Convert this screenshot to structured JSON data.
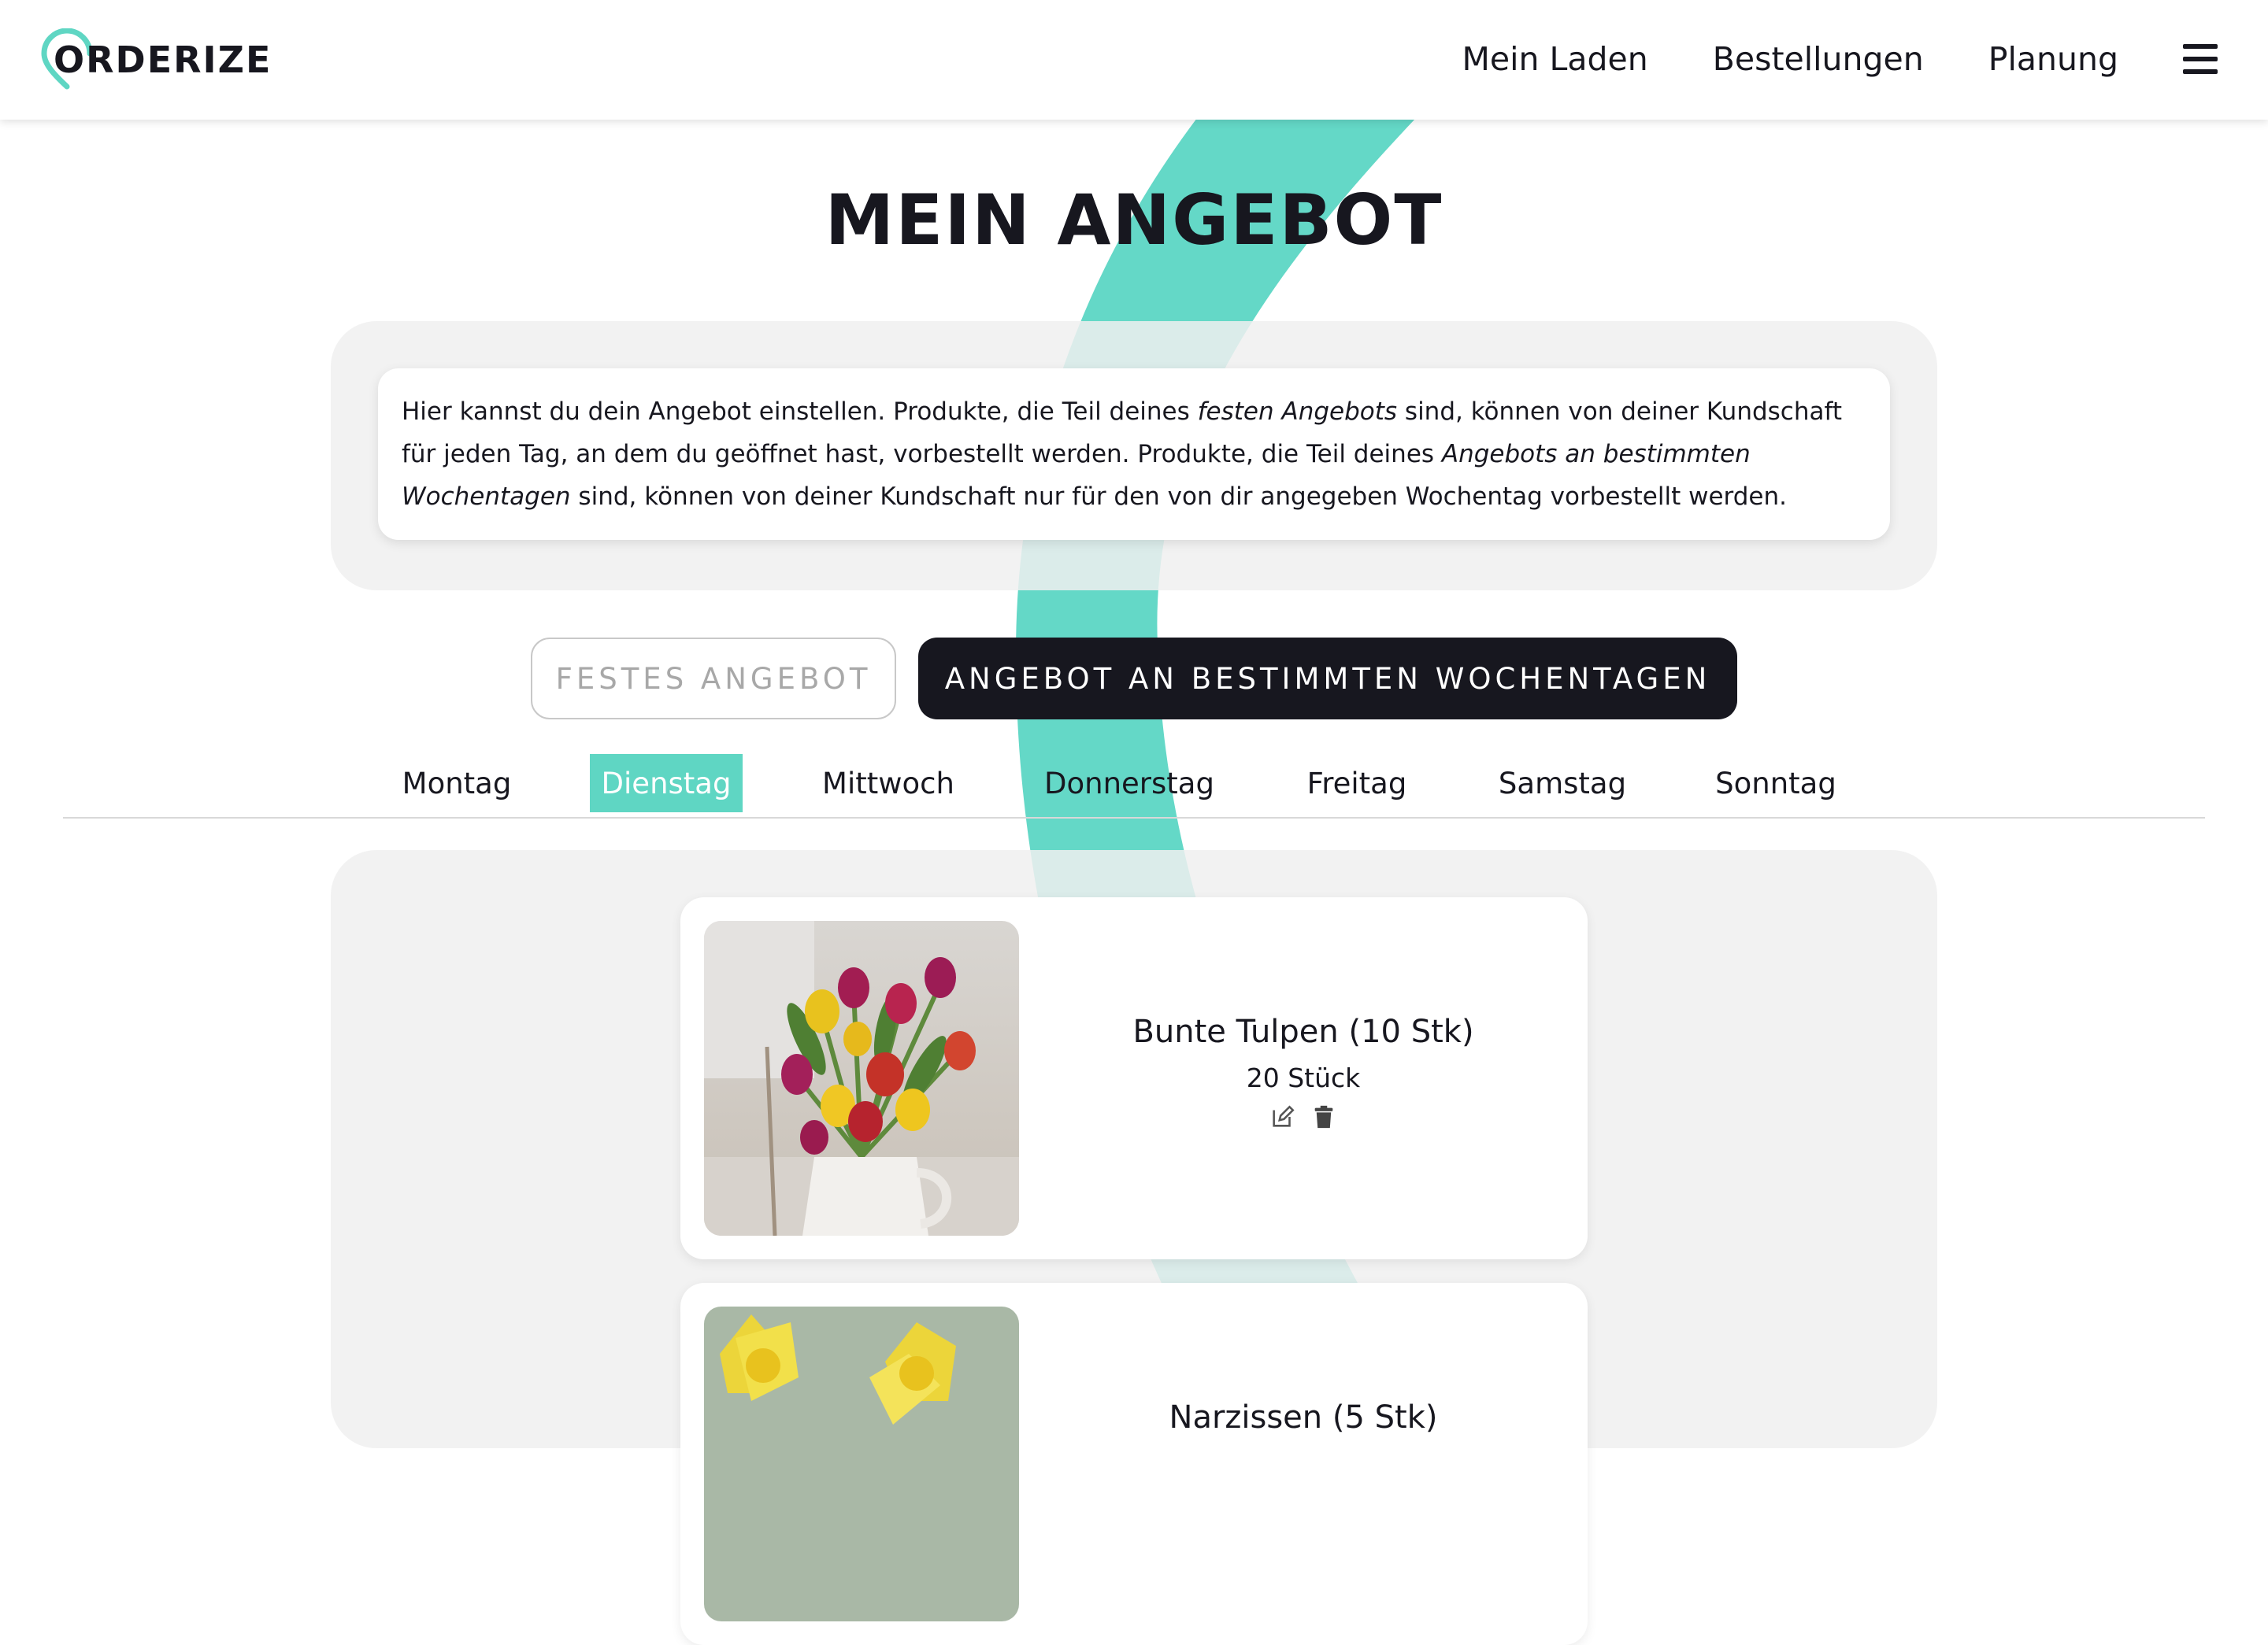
{
  "header": {
    "logo_text": "ORDERIZE",
    "nav": [
      "Mein Laden",
      "Bestellungen",
      "Planung"
    ]
  },
  "page": {
    "title": "MEIN ANGEBOT",
    "info": {
      "part1": "Hier kannst du dein Angebot einstellen. Produkte, die Teil deines ",
      "em1": "festen Angebots",
      "part2": " sind, können von deiner Kundschaft für jeden Tag, an dem du geöffnet hast, vorbestellt werden. Produkte, die Teil deines ",
      "em2": "Angebots an bestimmten Wochentagen",
      "part3": " sind, können von deiner Kundschaft nur für den von dir angegeben Wochentag vorbestellt werden."
    },
    "buttons": {
      "fixed": "FESTES ANGEBOT",
      "weekdays": "ANGEBOT AN BESTIMMTEN WOCHENTAGEN"
    },
    "days": [
      "Montag",
      "Dienstag",
      "Mittwoch",
      "Donnerstag",
      "Freitag",
      "Samstag",
      "Sonntag"
    ],
    "active_day": "Dienstag",
    "products": [
      {
        "name": "Bunte Tulpen (10 Stk)",
        "quantity": "20 Stück",
        "image": "tulips-vase-photo"
      },
      {
        "name": "Narzissen (5 Stk)",
        "quantity": "",
        "image": "daffodils-photo"
      }
    ]
  },
  "colors": {
    "accent": "#5fd6c3",
    "dark": "#17171f",
    "panel": "#f0f0f0"
  },
  "icons": {
    "logo": "location-pin-icon",
    "menu": "hamburger-menu-icon",
    "edit": "edit-icon",
    "delete": "trash-icon"
  }
}
